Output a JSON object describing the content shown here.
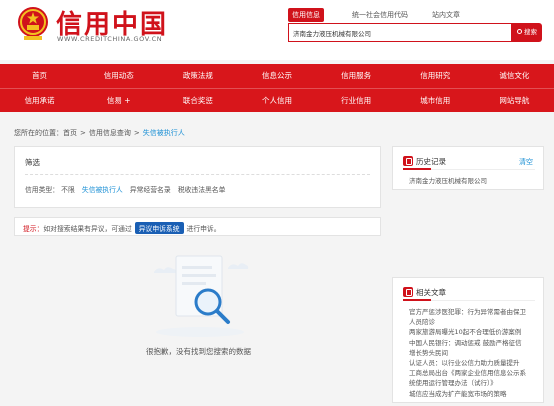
{
  "header": {
    "site_title": "信用中国",
    "site_url": "WWW.CREDITCHINA.GOV.CN",
    "search_tabs": [
      "信用信息",
      "统一社会信用代码",
      "站内文章"
    ],
    "search_value": "济南金力液压机械有限公司",
    "search_button": "搜索"
  },
  "nav": {
    "row1": [
      "首页",
      "信用动态",
      "政策法规",
      "信息公示",
      "信用服务",
      "信用研究",
      "诚信文化"
    ],
    "row2": [
      "信用承诺",
      "信易 +",
      "联合奖惩",
      "个人信用",
      "行业信用",
      "城市信用",
      "网站导航"
    ]
  },
  "breadcrumb": {
    "prefix": "您所在的位置：",
    "home": "首页",
    "section": "信用信息查询",
    "current": "失信被执行人",
    "separator": ">"
  },
  "filter": {
    "title": "筛选",
    "type_label": "信用类型：",
    "options": [
      "不限",
      "失信被执行人",
      "异常经营名录",
      "税收违法黑名单"
    ],
    "selected": "失信被执行人"
  },
  "tip": {
    "label": "提示：",
    "text_before": "如对搜索结果有异议，可通过",
    "button": "异议申诉系统",
    "text_after": "进行申诉。"
  },
  "empty": {
    "message": "很抱歉，没有找到您搜索的数据"
  },
  "history": {
    "title": "历史记录",
    "clear": "清空",
    "items": [
      "济南金力液压机械有限公司"
    ]
  },
  "related": {
    "title": "相关文章",
    "items": [
      "官方严惩涉医犯罪：行为异常需者由保卫",
      "人员陪诊",
      "两家旅游局曝光10起不合理低价游案例",
      "中国人民银行：调动惩戒 鼓励严格征信",
      "增长势头民间",
      "认证人员：以行业公信力助力质量提升",
      "工商总局出台《两家企业信用信息公示系",
      "统使用运行管理办法（试行）》",
      "城信应当成为扩产能宽市场的策略"
    ]
  },
  "colors": {
    "brand_red": "#d0121b",
    "nav_red": "#d8161b",
    "link_blue": "#1a8fd5",
    "button_blue": "#1a5fb4"
  }
}
